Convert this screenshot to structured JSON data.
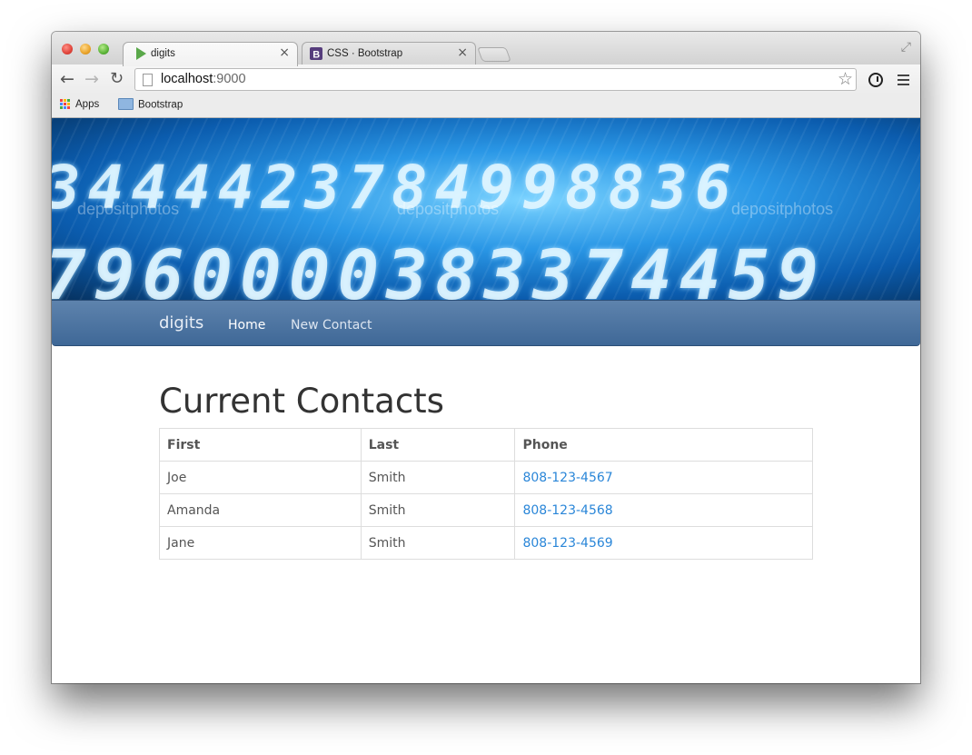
{
  "browser": {
    "tabs": [
      {
        "title": "digits",
        "favicon": "play-icon",
        "active": true
      },
      {
        "title": "CSS · Bootstrap",
        "favicon": "bootstrap-icon",
        "active": false
      }
    ],
    "close_glyph": "×",
    "url_host": "localhost",
    "url_port": ":9000",
    "bookmarks": [
      {
        "label": "Apps",
        "icon": "apps-grid-icon"
      },
      {
        "label": "Bootstrap",
        "icon": "folder-icon"
      }
    ]
  },
  "banner": {
    "row1": "3444423784998836",
    "row2": "7960000383374459",
    "watermark_1": "depositphotos",
    "watermark_2": "depositphotos",
    "watermark_3": "depositphotos"
  },
  "navbar": {
    "brand": "digits",
    "links": [
      {
        "label": "Home",
        "active": true
      },
      {
        "label": "New Contact",
        "active": false
      }
    ]
  },
  "main": {
    "heading": "Current Contacts",
    "table": {
      "headers": [
        "First",
        "Last",
        "Phone"
      ],
      "rows": [
        [
          "Joe",
          "Smith",
          "808-123-4567"
        ],
        [
          "Amanda",
          "Smith",
          "808-123-4568"
        ],
        [
          "Jane",
          "Smith",
          "808-123-4569"
        ]
      ]
    }
  },
  "colors": {
    "navbar": "#4a72a0",
    "link": "#2a86d8",
    "heading": "#333333"
  }
}
